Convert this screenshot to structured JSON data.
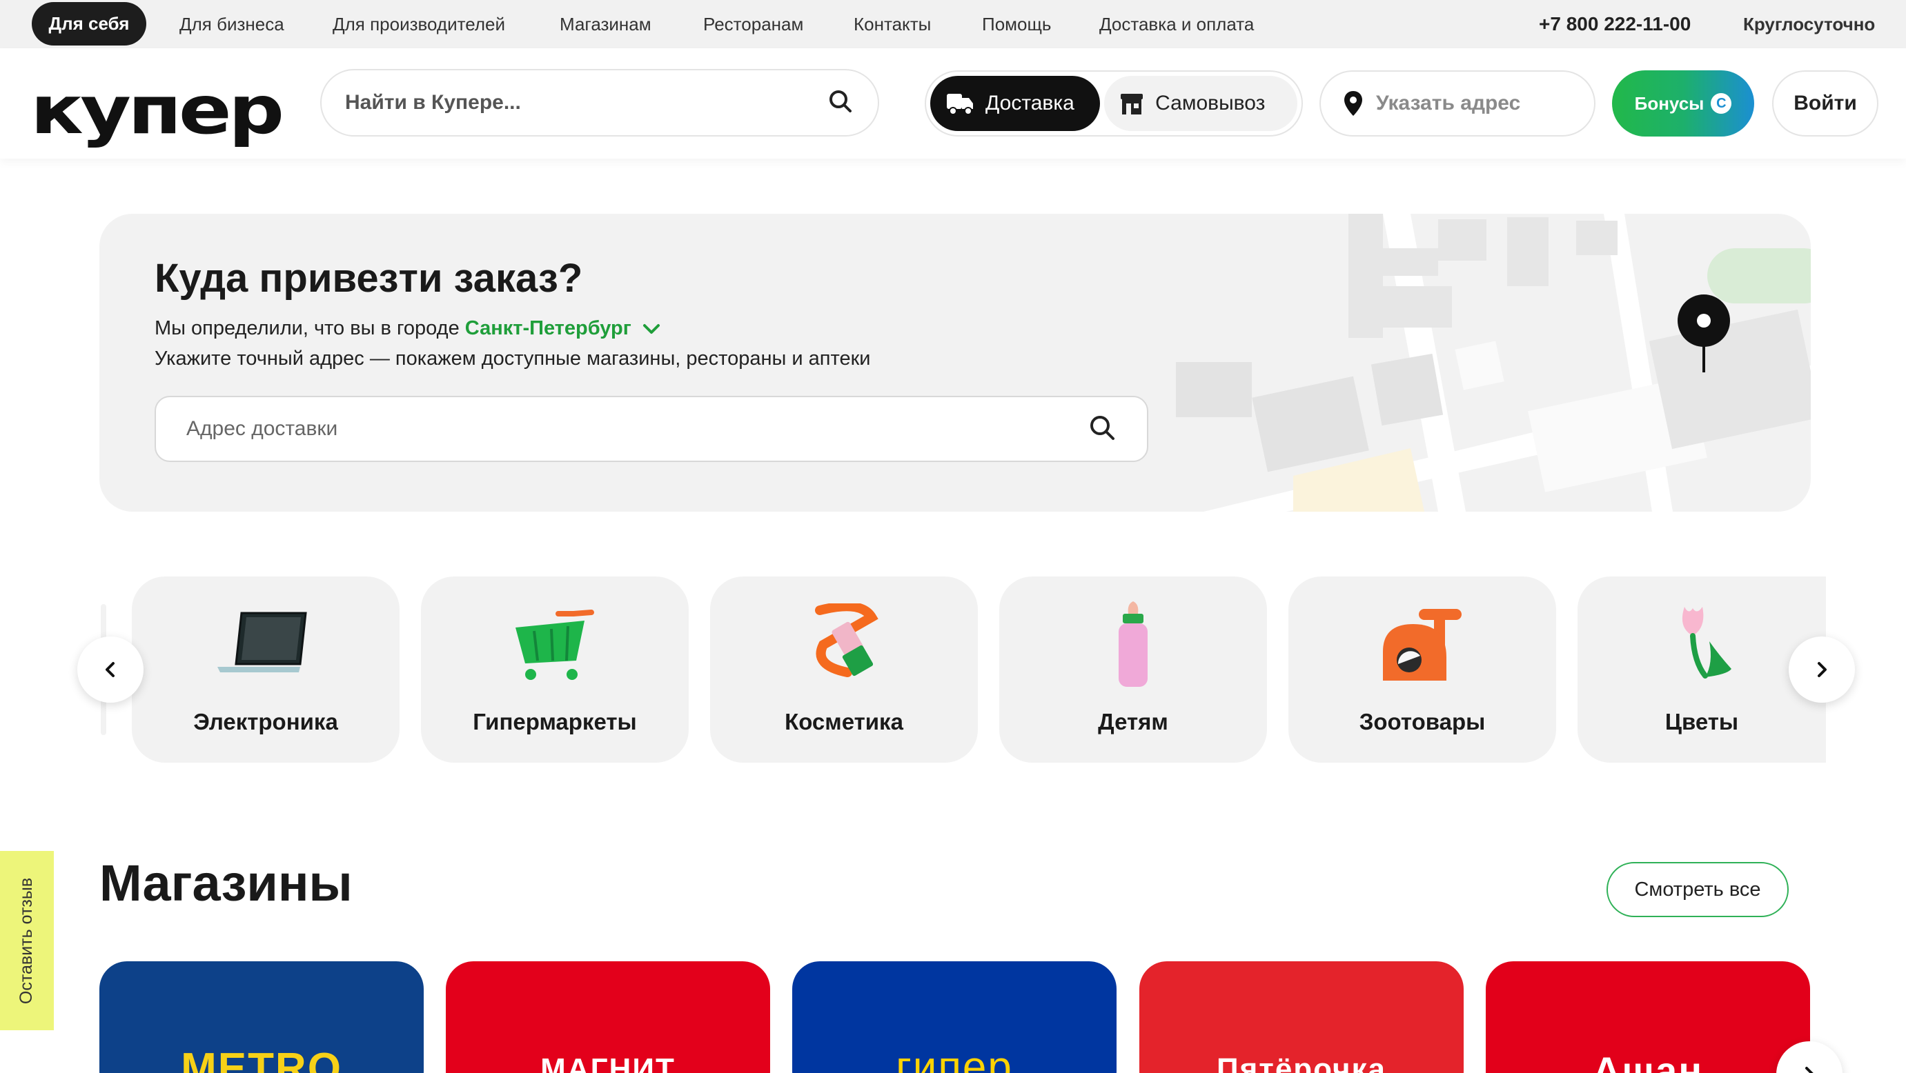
{
  "topnav": {
    "items": [
      "Для себя",
      "Для бизнеса",
      "Для производителей",
      "Магазинам",
      "Ресторанам",
      "Контакты",
      "Помощь",
      "Доставка и оплата"
    ],
    "phone": "+7 800 222-11-00",
    "hours": "Круглосуточно"
  },
  "header": {
    "logo": "купер",
    "search_placeholder": "Найти в Купере...",
    "delivery": "Доставка",
    "pickup": "Самовывоз",
    "address_placeholder": "Указать адрес",
    "bonus": "Бонусы",
    "bonus_badge": "С",
    "login": "Войти"
  },
  "hero": {
    "title": "Куда привезти заказ?",
    "line1_prefix": "Мы определили, что вы в городе",
    "city": "Санкт-Петербург",
    "line2": "Укажите точный адрес — покажем доступные магазины, рестораны и аптеки",
    "address_placeholder": "Адрес доставки"
  },
  "categories": [
    {
      "label": "Электроника",
      "icon": "laptop-icon"
    },
    {
      "label": "Гипермаркеты",
      "icon": "shopping-cart-icon"
    },
    {
      "label": "Косметика",
      "icon": "cosmetics-icon"
    },
    {
      "label": "Детям",
      "icon": "baby-bottle-icon"
    },
    {
      "label": "Зоотовары",
      "icon": "cat-house-icon"
    },
    {
      "label": "Цветы",
      "icon": "tulip-icon"
    }
  ],
  "stores": {
    "title": "Магазины",
    "see_all": "Смотреть все",
    "items": [
      {
        "name": "METRO",
        "bg": "#0d4189",
        "fg": "#f7d117"
      },
      {
        "name": "МАГНИТ",
        "bg": "#e3001b",
        "fg": "#ffffff"
      },
      {
        "name": "гипер",
        "bg": "#0036a0",
        "fg": "#ffd200"
      },
      {
        "name": "Пятёрочка",
        "bg": "#e4232b",
        "fg": "#ffffff"
      },
      {
        "name": "Ашан",
        "bg": "#e2001a",
        "fg": "#ffffff"
      }
    ]
  },
  "feedback": "Оставить отзыв",
  "colors": {
    "accent_green": "#1f9e3a",
    "dark": "#111111",
    "surface": "#f2f2f2"
  }
}
